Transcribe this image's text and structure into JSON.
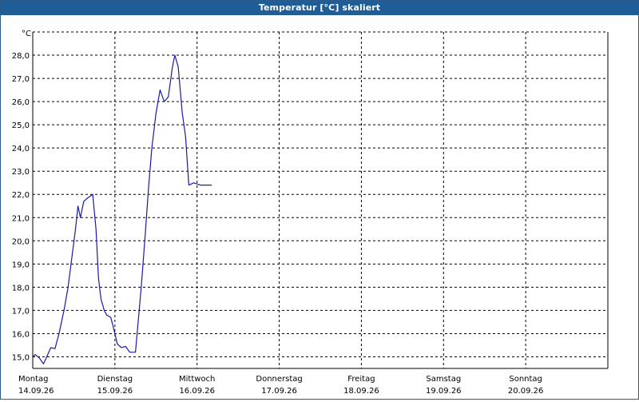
{
  "window": {
    "title": "Temperatur [°C] skaliert"
  },
  "colors": {
    "title_bar": "#1f5d96",
    "line": "#1a1aa8",
    "grid": "#000000"
  },
  "chart_data": {
    "type": "line",
    "title": "Temperatur [°C] skaliert",
    "ylabel": "°C",
    "ylim": [
      14.5,
      29.0
    ],
    "yticks": [
      15.0,
      16.0,
      17.0,
      18.0,
      19.0,
      20.0,
      21.0,
      22.0,
      23.0,
      24.0,
      25.0,
      26.0,
      27.0,
      28.0
    ],
    "ytick_labels": [
      "15,0",
      "16,0",
      "17,0",
      "18,0",
      "19,0",
      "20,0",
      "21,0",
      "22,0",
      "23,0",
      "24,0",
      "25,0",
      "26,0",
      "27,0",
      "28,0"
    ],
    "xlim": [
      0,
      7
    ],
    "xticks": [
      {
        "day": "Montag",
        "date": "14.09.26"
      },
      {
        "day": "Dienstag",
        "date": "15.09.26"
      },
      {
        "day": "Mittwoch",
        "date": "16.09.26"
      },
      {
        "day": "Donnerstag",
        "date": "17.09.26"
      },
      {
        "day": "Freitag",
        "date": "18.09.26"
      },
      {
        "day": "Samstag",
        "date": "19.09.26"
      },
      {
        "day": "Sonntag",
        "date": "20.09.26"
      }
    ],
    "grid": true,
    "series": [
      {
        "x": [
          0.0,
          0.03,
          0.08,
          0.13,
          0.17,
          0.22,
          0.27,
          0.32,
          0.38,
          0.43,
          0.48,
          0.52,
          0.55,
          0.58,
          0.62,
          0.67,
          0.73,
          0.77,
          0.8,
          0.83,
          0.87,
          0.9,
          0.95,
          1.0,
          1.03,
          1.08,
          1.13,
          1.18,
          1.25,
          1.32,
          1.37,
          1.41,
          1.45,
          1.5,
          1.55,
          1.6,
          1.65,
          1.7,
          1.73,
          1.77,
          1.82,
          1.86,
          1.9,
          1.93,
          1.96,
          2.0,
          2.04,
          2.09,
          2.14,
          2.18
        ],
        "y": [
          15.0,
          15.1,
          14.95,
          14.7,
          15.0,
          15.4,
          15.35,
          16.0,
          17.0,
          18.0,
          19.4,
          20.5,
          21.5,
          21.0,
          21.7,
          21.85,
          22.0,
          20.5,
          18.4,
          17.5,
          17.0,
          16.8,
          16.7,
          16.0,
          15.55,
          15.4,
          15.45,
          15.2,
          15.2,
          18.0,
          20.3,
          22.3,
          24.0,
          25.5,
          26.5,
          26.0,
          26.2,
          27.5,
          28.0,
          27.5,
          25.5,
          24.5,
          22.4,
          22.45,
          22.5,
          22.45,
          22.4,
          22.4,
          22.4,
          22.4
        ]
      }
    ]
  }
}
